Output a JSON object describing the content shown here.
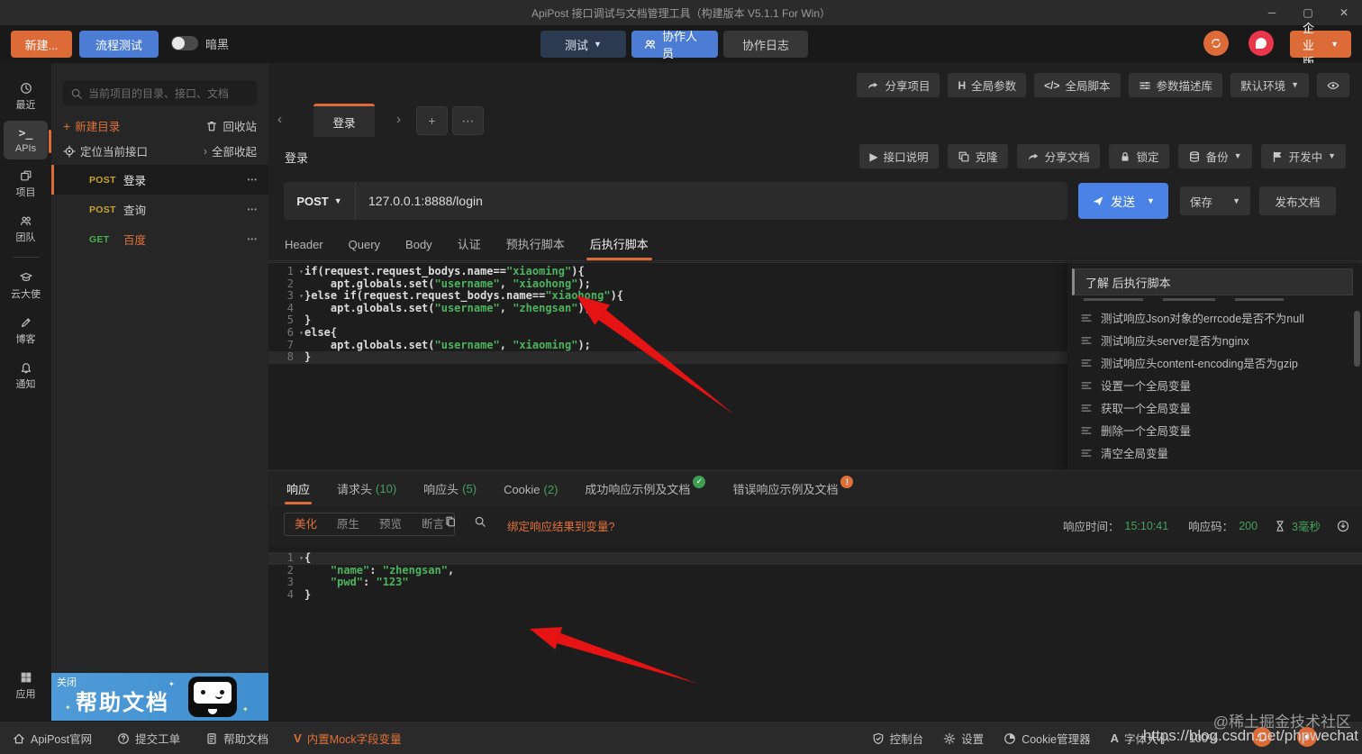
{
  "window": {
    "title": "ApiPost 接口调试与文档管理工具（构建版本 V5.1.1 For Win）",
    "minimize": "─",
    "maximize": "▢",
    "close": "✕"
  },
  "toolbar": {
    "new_label": "新建...",
    "flow_label": "流程测试",
    "theme_label": "暗黑",
    "test_label": "测试",
    "collab_label": "协作人员",
    "log_label": "协作日志",
    "enterprise_label": "企业版"
  },
  "navrail": {
    "items": [
      {
        "icon": "clock",
        "label": "最近",
        "active": false
      },
      {
        "icon": "txt:>_",
        "label": "APIs",
        "active": true
      },
      {
        "icon": "project",
        "label": "项目",
        "active": false
      },
      {
        "icon": "users",
        "label": "团队",
        "active": false,
        "divider_after": true
      },
      {
        "icon": "grad",
        "label": "云大使",
        "active": false
      },
      {
        "icon": "pen",
        "label": "博客",
        "active": false
      },
      {
        "icon": "bell",
        "label": "通知",
        "active": false
      }
    ],
    "bottom_item": {
      "icon": "grid",
      "label": "应用"
    }
  },
  "sidebar": {
    "search_placeholder": "当前项目的目录、接口、文档",
    "new_dir": "新建目录",
    "recycle": "回收站",
    "locate": "定位当前接口",
    "collapse": "全部收起",
    "tree": [
      {
        "method": "POST",
        "method_color": "#c9a232",
        "name": "登录",
        "name_color": "#e8e8e8",
        "selected": true
      },
      {
        "method": "POST",
        "method_color": "#c9a232",
        "name": "查询",
        "name_color": "#cfcfcf",
        "selected": false
      },
      {
        "method": "GET",
        "method_color": "#4caf50",
        "name": "百度",
        "name_color": "#e0703a",
        "selected": false
      }
    ]
  },
  "banner": {
    "close_label": "关闭",
    "title": "帮助文档"
  },
  "project_toolbar": {
    "buttons": [
      {
        "icon": "share",
        "label": "分享项目"
      },
      {
        "icon": "txt:H",
        "label": "全局参数"
      },
      {
        "icon": "txt:</>",
        "label": "全局脚本"
      },
      {
        "icon": "sliders",
        "label": "参数描述库"
      },
      {
        "icon": "",
        "label": "默认环境",
        "caret": true
      },
      {
        "icon": "eye",
        "label": ""
      }
    ]
  },
  "tabstrip": {
    "tab_label": "登录",
    "prev": "‹",
    "next": "›",
    "add": "+",
    "more": "⋯"
  },
  "doc": {
    "title": "登录",
    "buttons": [
      {
        "icon": "txt:▶",
        "label": "接口说明"
      },
      {
        "icon": "clone",
        "label": "克隆"
      },
      {
        "icon": "share",
        "label": "分享文档"
      },
      {
        "icon": "lock",
        "label": "锁定"
      },
      {
        "icon": "db",
        "label": "备份",
        "caret": true
      },
      {
        "icon": "flag",
        "label": "开发中",
        "caret": true
      }
    ]
  },
  "request": {
    "method": "POST",
    "url": "127.0.0.1:8888/login",
    "send": "发送",
    "save": "保存",
    "publish": "发布文档"
  },
  "req_tabs": {
    "items": [
      {
        "label": "Header",
        "active": false
      },
      {
        "label": "Query",
        "active": false
      },
      {
        "label": "Body",
        "active": false
      },
      {
        "label": "认证",
        "active": false
      },
      {
        "label": "预执行脚本",
        "active": false
      },
      {
        "label": "后执行脚本",
        "active": true
      }
    ]
  },
  "editor": {
    "lines": [
      {
        "n": "1",
        "fold": true,
        "active": false,
        "tokens": [
          [
            "p",
            "if(request.request_bodys.name=="
          ],
          [
            "s",
            "\"xiaoming\""
          ],
          [
            "p",
            "){"
          ]
        ]
      },
      {
        "n": "2",
        "fold": false,
        "active": false,
        "tokens": [
          [
            "p",
            "    apt.globals.set("
          ],
          [
            "s",
            "\"username\""
          ],
          [
            "p",
            ", "
          ],
          [
            "s",
            "\"xiaohong\""
          ],
          [
            "p",
            ");"
          ]
        ]
      },
      {
        "n": "3",
        "fold": true,
        "active": false,
        "tokens": [
          [
            "p",
            "}else if(request.request_bodys.name=="
          ],
          [
            "s",
            "\"xiaohong\""
          ],
          [
            "p",
            "){"
          ]
        ]
      },
      {
        "n": "4",
        "fold": false,
        "active": false,
        "tokens": [
          [
            "p",
            "    apt.globals.set("
          ],
          [
            "s",
            "\"username\""
          ],
          [
            "p",
            ", "
          ],
          [
            "s",
            "\"zhengsan\""
          ],
          [
            "p",
            ");"
          ]
        ]
      },
      {
        "n": "5",
        "fold": false,
        "active": false,
        "tokens": [
          [
            "p",
            "}"
          ]
        ]
      },
      {
        "n": "6",
        "fold": true,
        "active": false,
        "tokens": [
          [
            "p",
            "else{"
          ]
        ]
      },
      {
        "n": "7",
        "fold": false,
        "active": false,
        "tokens": [
          [
            "p",
            "    apt.globals.set("
          ],
          [
            "s",
            "\"username\""
          ],
          [
            "p",
            ", "
          ],
          [
            "s",
            "\"xiaoming\""
          ],
          [
            "p",
            ");"
          ]
        ]
      },
      {
        "n": "8",
        "fold": false,
        "active": true,
        "tokens": [
          [
            "p",
            "}"
          ]
        ]
      }
    ]
  },
  "script_panel": {
    "header": "了解 后执行脚本",
    "items": [
      "测试响应Json对象的errcode是否不为null",
      "测试响应头server是否为nginx",
      "测试响应头content-encoding是否为gzip",
      "设置一个全局变量",
      "获取一个全局变量",
      "删除一个全局变量",
      "清空全局变量"
    ]
  },
  "resp_tabs": {
    "items": [
      {
        "label": "响应",
        "active": true
      },
      {
        "label": "请求头",
        "count": "(10)"
      },
      {
        "label": "响应头",
        "count": "(5)"
      },
      {
        "label": "Cookie",
        "count": "(2)"
      },
      {
        "label": "成功响应示例及文档",
        "badge": "check"
      },
      {
        "label": "错误响应示例及文档",
        "badge": "excl"
      }
    ]
  },
  "resp_toolbar": {
    "modes": [
      {
        "label": "美化",
        "active": true
      },
      {
        "label": "原生",
        "active": false
      },
      {
        "label": "预览",
        "active": false
      },
      {
        "label": "断言",
        "active": false
      }
    ],
    "bind_link": "绑定响应结果到变量?",
    "time_label": "响应时间：",
    "time_value": "15:10:41",
    "code_label": "响应码：",
    "code_value": "200",
    "duration": "3毫秒"
  },
  "response": {
    "lines": [
      {
        "n": "1",
        "fold": true,
        "active": true,
        "tokens": [
          [
            "p",
            "{"
          ]
        ]
      },
      {
        "n": "2",
        "fold": false,
        "active": false,
        "tokens": [
          [
            "p",
            "    "
          ],
          [
            "s",
            "\"name\""
          ],
          [
            "p",
            ": "
          ],
          [
            "s",
            "\"zhengsan\""
          ],
          [
            "p",
            ","
          ]
        ]
      },
      {
        "n": "3",
        "fold": false,
        "active": false,
        "tokens": [
          [
            "p",
            "    "
          ],
          [
            "s",
            "\"pwd\""
          ],
          [
            "p",
            ": "
          ],
          [
            "s",
            "\"123\""
          ]
        ]
      },
      {
        "n": "4",
        "fold": false,
        "active": false,
        "tokens": [
          [
            "p",
            "}"
          ]
        ]
      }
    ]
  },
  "statusbar": {
    "left": [
      {
        "icon": "home",
        "label": "ApiPost官网"
      },
      {
        "icon": "question",
        "label": "提交工单"
      },
      {
        "icon": "docbook",
        "label": "帮助文档"
      },
      {
        "icon": "txt:V",
        "label": "内置Mock字段变量",
        "orange": true
      }
    ],
    "right": [
      {
        "icon": "shield",
        "label": "控制台"
      },
      {
        "icon": "gear",
        "label": "设置"
      },
      {
        "icon": "cookie",
        "label": "Cookie管理器"
      },
      {
        "icon": "txt:A",
        "label": "字体大小"
      },
      {
        "icon": "",
        "label": "100%"
      }
    ]
  },
  "watermark": {
    "line1": "@稀土掘金技术社区",
    "line2": "https://blog.csdn.net/phpwechat"
  },
  "colors": {
    "accent_orange": "#dc6b37",
    "accent_blue": "#4c7cd3",
    "send_blue": "#4a82e6",
    "string_green": "#4db35f",
    "value_green": "#45a15e",
    "arrow_red": "#e51313"
  }
}
